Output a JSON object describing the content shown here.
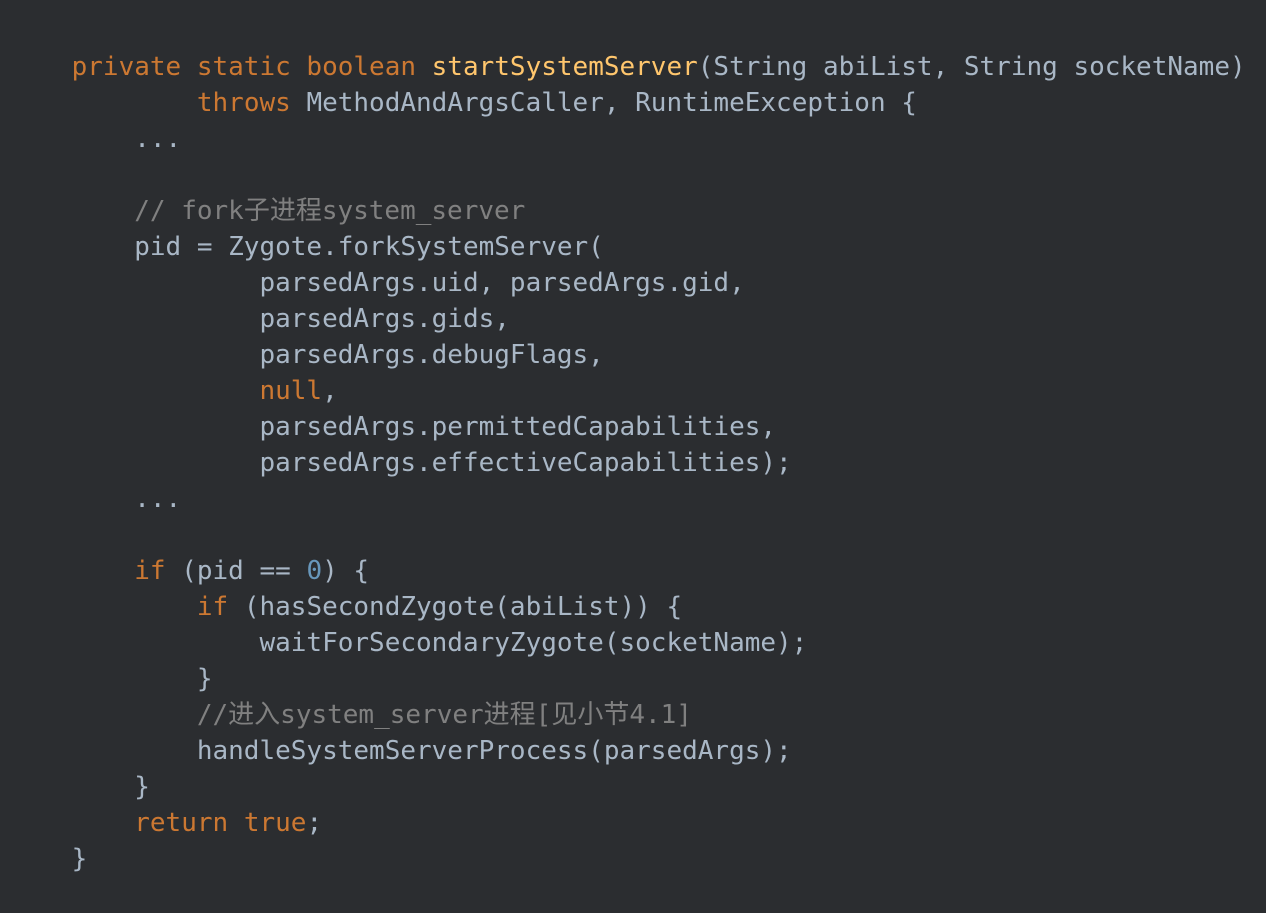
{
  "colors": {
    "background": "#2b2d30",
    "keyword": "#cc7832",
    "function_declaration": "#ffc66d",
    "text": "#a9b7c6",
    "comment": "#808080",
    "number": "#6897bb"
  },
  "code": {
    "lines": [
      {
        "tokens": [
          {
            "t": "kw",
            "v": "private static boolean "
          },
          {
            "t": "fn",
            "v": "startSystemServer"
          },
          {
            "t": "tx",
            "v": "(String abiList, String socketName)"
          }
        ]
      },
      {
        "tokens": [
          {
            "t": "tx",
            "v": "        "
          },
          {
            "t": "kw",
            "v": "throws "
          },
          {
            "t": "tx",
            "v": "MethodAndArgsCaller, RuntimeException {"
          }
        ]
      },
      {
        "tokens": [
          {
            "t": "tx",
            "v": "    ..."
          }
        ]
      },
      {
        "tokens": []
      },
      {
        "tokens": [
          {
            "t": "tx",
            "v": "    "
          },
          {
            "t": "cm",
            "v": "// fork子进程system_server"
          }
        ]
      },
      {
        "tokens": [
          {
            "t": "tx",
            "v": "    pid = Zygote.forkSystemServer("
          }
        ]
      },
      {
        "tokens": [
          {
            "t": "tx",
            "v": "            parsedArgs.uid, parsedArgs.gid,"
          }
        ]
      },
      {
        "tokens": [
          {
            "t": "tx",
            "v": "            parsedArgs.gids,"
          }
        ]
      },
      {
        "tokens": [
          {
            "t": "tx",
            "v": "            parsedArgs.debugFlags,"
          }
        ]
      },
      {
        "tokens": [
          {
            "t": "tx",
            "v": "            "
          },
          {
            "t": "kw",
            "v": "null"
          },
          {
            "t": "tx",
            "v": ","
          }
        ]
      },
      {
        "tokens": [
          {
            "t": "tx",
            "v": "            parsedArgs.permittedCapabilities,"
          }
        ]
      },
      {
        "tokens": [
          {
            "t": "tx",
            "v": "            parsedArgs.effectiveCapabilities);"
          }
        ]
      },
      {
        "tokens": [
          {
            "t": "tx",
            "v": "    ..."
          }
        ]
      },
      {
        "tokens": []
      },
      {
        "tokens": [
          {
            "t": "tx",
            "v": "    "
          },
          {
            "t": "kw",
            "v": "if"
          },
          {
            "t": "tx",
            "v": " (pid == "
          },
          {
            "t": "nm",
            "v": "0"
          },
          {
            "t": "tx",
            "v": ") {"
          }
        ]
      },
      {
        "tokens": [
          {
            "t": "tx",
            "v": "        "
          },
          {
            "t": "kw",
            "v": "if"
          },
          {
            "t": "tx",
            "v": " (hasSecondZygote(abiList)) {"
          }
        ]
      },
      {
        "tokens": [
          {
            "t": "tx",
            "v": "            waitForSecondaryZygote(socketName);"
          }
        ]
      },
      {
        "tokens": [
          {
            "t": "tx",
            "v": "        }"
          }
        ]
      },
      {
        "tokens": [
          {
            "t": "tx",
            "v": "        "
          },
          {
            "t": "cm",
            "v": "//进入system_server进程[见小节4.1]"
          }
        ]
      },
      {
        "tokens": [
          {
            "t": "tx",
            "v": "        handleSystemServerProcess(parsedArgs);"
          }
        ]
      },
      {
        "tokens": [
          {
            "t": "tx",
            "v": "    }"
          }
        ]
      },
      {
        "tokens": [
          {
            "t": "tx",
            "v": "    "
          },
          {
            "t": "kw",
            "v": "return true"
          },
          {
            "t": "tx",
            "v": ";"
          }
        ]
      },
      {
        "tokens": [
          {
            "t": "tx",
            "v": "}"
          }
        ]
      }
    ]
  }
}
